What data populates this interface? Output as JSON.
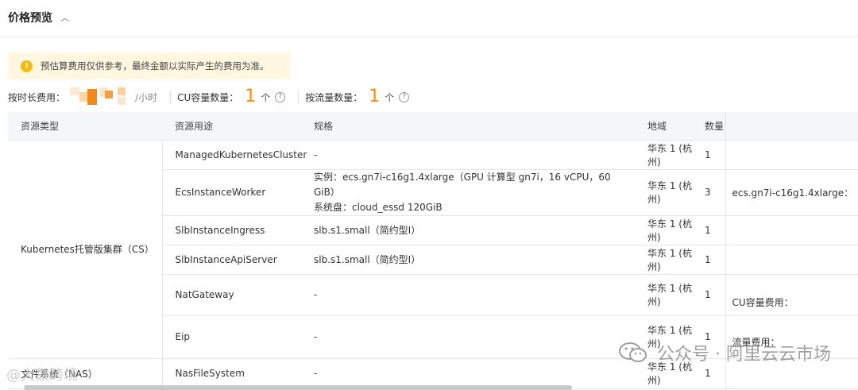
{
  "section": {
    "title": "价格预览",
    "collapse_icon": "chevron-up-icon"
  },
  "notice": {
    "icon": "info-icon",
    "icon_glyph": "!",
    "text": "预估算费用仅供参考，最终金额以实际产生的费用为准。"
  },
  "fees": {
    "hourly_label": "按时长费用：",
    "hourly_unit": "/小时",
    "cu_label": "CU容量数量：",
    "cu_count": "1",
    "cu_unit": "个",
    "traffic_label": "按流量数量：",
    "traffic_count": "1",
    "traffic_unit": "个",
    "help_glyph": "?"
  },
  "table": {
    "headers": [
      "资源类型",
      "资源用途",
      "规格",
      "地域",
      "数量"
    ],
    "groups": [
      {
        "type": "Kubernetes托管版集群（CS）",
        "rows": [
          {
            "usage": "ManagedKubernetesCluster",
            "spec": [
              "-"
            ],
            "region": "华东 1 (杭州)",
            "qty": "1"
          },
          {
            "usage": "EcsInstanceWorker",
            "spec": [
              "实例：ecs.gn7i-c16g1.4xlarge（GPU 计算型 gn7i，16 vCPU，60 GiB）",
              "系统盘：cloud_essd 120GiB"
            ],
            "region": "华东 1 (杭州)",
            "qty": "3"
          },
          {
            "usage": "SlbInstanceIngress",
            "spec": [
              "slb.s1.small（简约型I）"
            ],
            "region": "华东 1 (杭州)",
            "qty": "1"
          },
          {
            "usage": "SlbInstanceApiServer",
            "spec": [
              "slb.s1.small（简约型I）"
            ],
            "region": "华东 1 (杭州)",
            "qty": "1"
          },
          {
            "usage": "NatGateway",
            "spec": [
              "-"
            ],
            "region": "华东 1 (杭州)",
            "qty": "1"
          },
          {
            "usage": "Eip",
            "spec": [
              "-"
            ],
            "region": "华东 1 (杭州)",
            "qty": "1"
          }
        ]
      },
      {
        "type": "文件系统（NAS）",
        "rows": [
          {
            "usage": "NasFileSystem",
            "spec": [
              "-"
            ],
            "region": "华东 1 (杭州)",
            "qty": "1"
          }
        ]
      }
    ],
    "side": {
      "instance_label": "ecs.gn7i-c16g1.4xlarge：",
      "cu_fee_label": "CU容量费用：",
      "traffic_fee_label": "流量费用："
    }
  },
  "watermark": {
    "text": "公众号 · 阿里云云市场",
    "left_text": "@大数跨境"
  }
}
